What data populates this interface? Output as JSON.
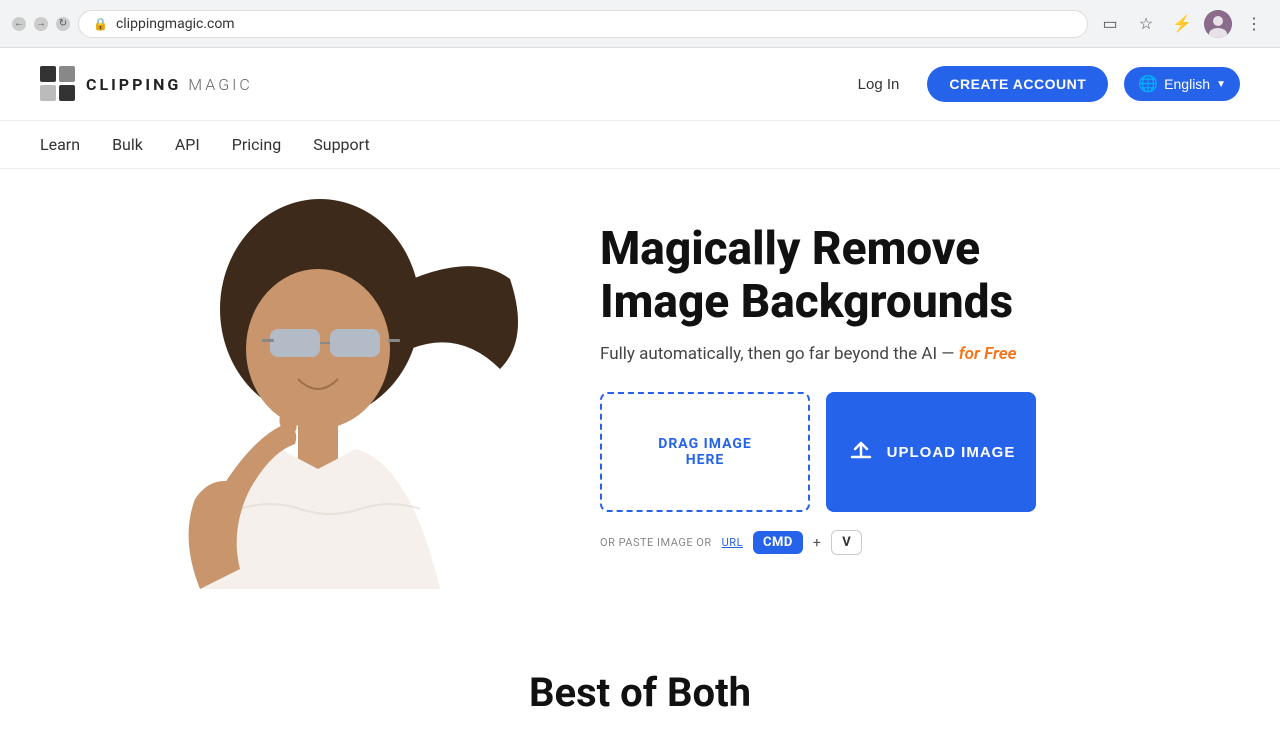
{
  "browser": {
    "url": "clippingmagic.com",
    "back_title": "Back",
    "forward_title": "Forward",
    "reload_title": "Reload"
  },
  "header": {
    "logo_text": "CLIPPING",
    "logo_magic": "MAGIC",
    "login_label": "Log In",
    "create_account_label": "CREATE ACCOUNT",
    "language_label": "English"
  },
  "nav": {
    "items": [
      {
        "label": "Learn",
        "href": "#"
      },
      {
        "label": "Bulk",
        "href": "#"
      },
      {
        "label": "API",
        "href": "#"
      },
      {
        "label": "Pricing",
        "href": "#"
      },
      {
        "label": "Support",
        "href": "#"
      }
    ]
  },
  "hero": {
    "title": "Magically Remove Image Backgrounds",
    "subtitle_plain": "Fully automatically, then go far beyond the AI — ",
    "subtitle_free": "for Free",
    "drag_zone_text": "DRAG IMAGE\nHERE",
    "upload_label": "UPLOAD IMAGE",
    "paste_text": "OR PASTE IMAGE OR",
    "url_link": "URL",
    "cmd_label": "CMD",
    "v_label": "V",
    "plus": "+"
  },
  "bottom": {
    "title": "Best of Both"
  }
}
